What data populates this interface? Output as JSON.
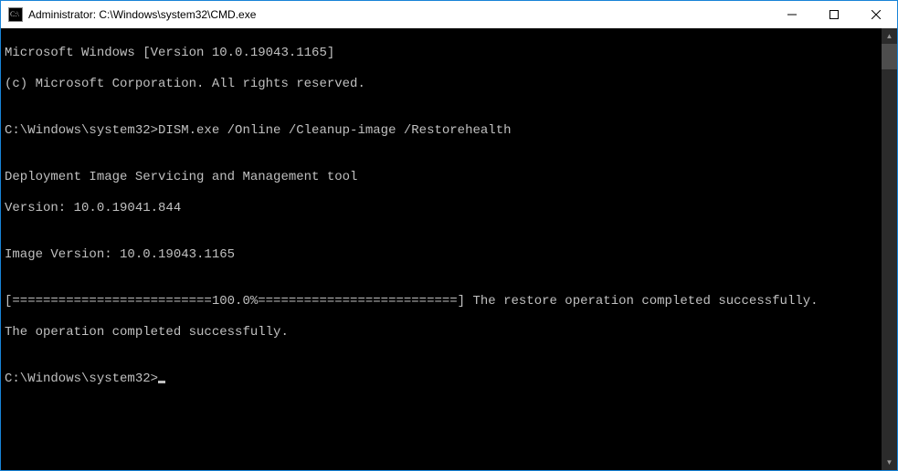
{
  "window": {
    "title": "Administrator: C:\\Windows\\system32\\CMD.exe"
  },
  "terminal": {
    "line1": "Microsoft Windows [Version 10.0.19043.1165]",
    "line2": "(c) Microsoft Corporation. All rights reserved.",
    "blank1": "",
    "prompt1": "C:\\Windows\\system32>DISM.exe /Online /Cleanup-image /Restorehealth",
    "blank2": "",
    "tool1": "Deployment Image Servicing and Management tool",
    "tool2": "Version: 10.0.19041.844",
    "blank3": "",
    "imgver": "Image Version: 10.0.19043.1165",
    "blank4": "",
    "progress": "[==========================100.0%==========================] The restore operation completed successfully.",
    "complete": "The operation completed successfully.",
    "blank5": "",
    "prompt2": "C:\\Windows\\system32>"
  }
}
